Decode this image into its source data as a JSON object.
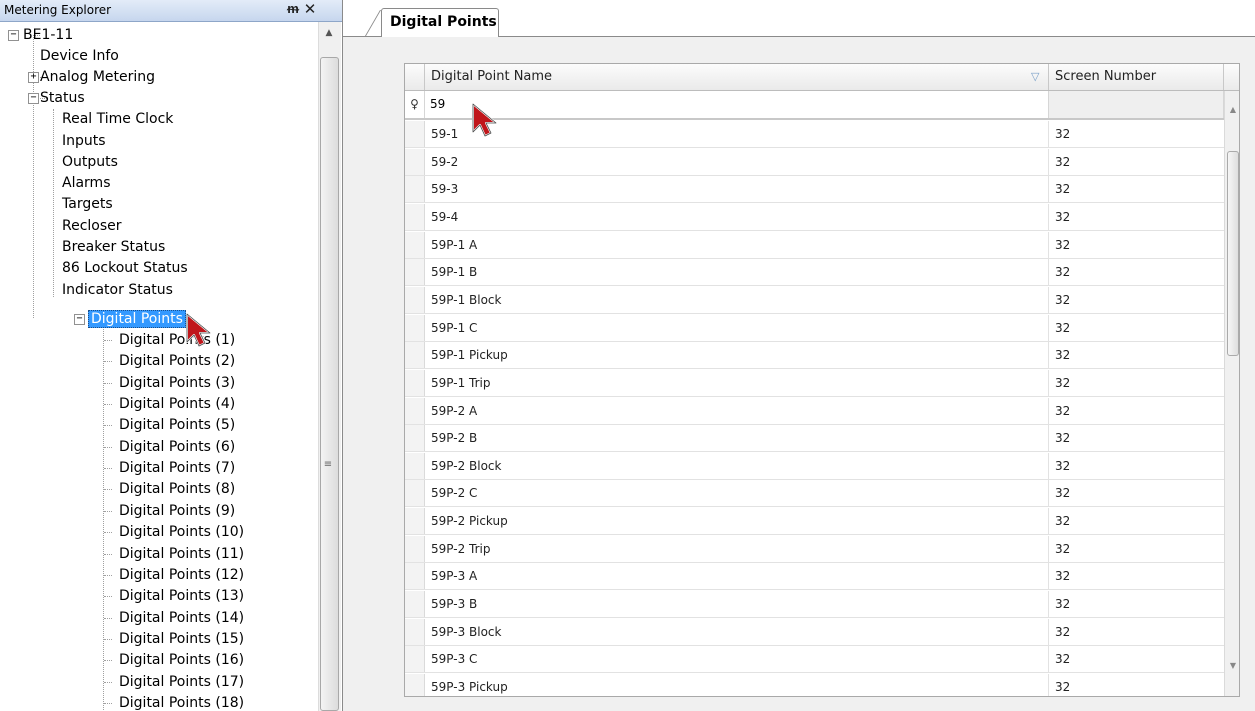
{
  "explorer": {
    "title": "Metering Explorer",
    "pin_icon": "pin-icon",
    "close_icon": "close-icon"
  },
  "tree": {
    "root": "BE1-11",
    "device_info": "Device Info",
    "analog_metering": "Analog Metering",
    "status": "Status",
    "status_children": [
      "Real Time Clock",
      "Inputs",
      "Outputs",
      "Alarms",
      "Targets",
      "Recloser",
      "Breaker Status",
      "86 Lockout Status",
      "Indicator Status"
    ],
    "digital_points": "Digital Points",
    "digital_points_children": [
      "Digital Points (1)",
      "Digital Points (2)",
      "Digital Points (3)",
      "Digital Points (4)",
      "Digital Points (5)",
      "Digital Points (6)",
      "Digital Points (7)",
      "Digital Points (8)",
      "Digital Points (9)",
      "Digital Points (10)",
      "Digital Points (11)",
      "Digital Points (12)",
      "Digital Points (13)",
      "Digital Points (14)",
      "Digital Points (15)",
      "Digital Points (16)",
      "Digital Points (17)",
      "Digital Points (18)"
    ]
  },
  "tab": {
    "label": "Digital Points"
  },
  "grid": {
    "columns": [
      "Digital Point Name",
      "Screen Number"
    ],
    "filter": {
      "name_value": "59",
      "screen_value": ""
    },
    "rows": [
      {
        "name": "59-1",
        "screen": "32"
      },
      {
        "name": "59-2",
        "screen": "32"
      },
      {
        "name": "59-3",
        "screen": "32"
      },
      {
        "name": "59-4",
        "screen": "32"
      },
      {
        "name": "59P-1 A",
        "screen": "32"
      },
      {
        "name": "59P-1 B",
        "screen": "32"
      },
      {
        "name": "59P-1 Block",
        "screen": "32"
      },
      {
        "name": "59P-1 C",
        "screen": "32"
      },
      {
        "name": "59P-1 Pickup",
        "screen": "32"
      },
      {
        "name": "59P-1 Trip",
        "screen": "32"
      },
      {
        "name": "59P-2 A",
        "screen": "32"
      },
      {
        "name": "59P-2 B",
        "screen": "32"
      },
      {
        "name": "59P-2 Block",
        "screen": "32"
      },
      {
        "name": "59P-2 C",
        "screen": "32"
      },
      {
        "name": "59P-2 Pickup",
        "screen": "32"
      },
      {
        "name": "59P-2 Trip",
        "screen": "32"
      },
      {
        "name": "59P-3 A",
        "screen": "32"
      },
      {
        "name": "59P-3 B",
        "screen": "32"
      },
      {
        "name": "59P-3 Block",
        "screen": "32"
      },
      {
        "name": "59P-3 C",
        "screen": "32"
      },
      {
        "name": "59P-3 Pickup",
        "screen": "32"
      }
    ]
  },
  "colors": {
    "selection": "#3399ff",
    "cursor_fill": "#c0161b",
    "header_gradient_top": "#e3ecf8"
  }
}
